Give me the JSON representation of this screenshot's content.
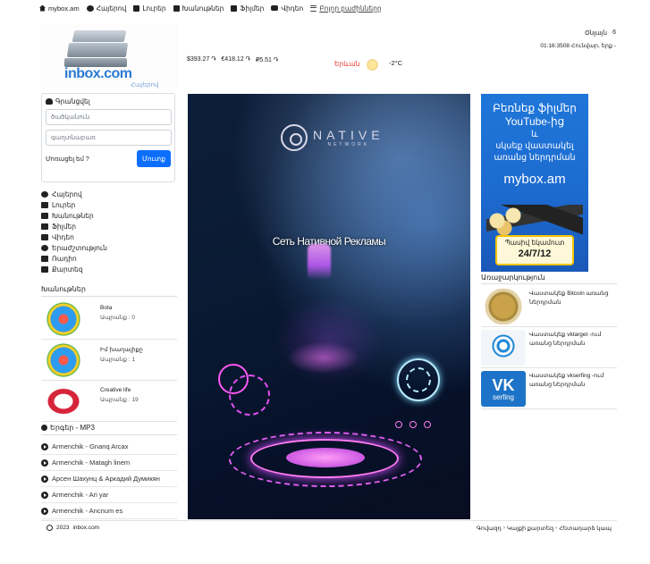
{
  "nav": {
    "site": "mybox.am",
    "items": [
      "Հայերով",
      "Լուրեր",
      "Խանութներ",
      "Ֆիլմեր",
      "Վիդեո"
    ],
    "all_sections": "Բոլոր բաժինները"
  },
  "logo": {
    "name": "inbox.com",
    "sub": "Հայերով"
  },
  "currency": {
    "usd": "$393.27 ֏",
    "eur": "€418.12 ֏",
    "rub": "₽5.51 ֏"
  },
  "weather": {
    "city": "Երևան",
    "temp": "-2°C"
  },
  "clock": {
    "label": "Օնլայն",
    "count": "6",
    "datetime": "01:16:3508 Հունվար, երք -"
  },
  "login": {
    "title": "Գրանցվել",
    "username_placeholder": "ծածկանուն",
    "password_placeholder": "գաղտնաբառ",
    "forgot": "Մոռացել եմ ?",
    "submit": "Մուտք"
  },
  "sidemenu": [
    "Հայերով",
    "Լուրեր",
    "Խանութներ",
    "Ֆիլմեր",
    "Վիդեո",
    "Երաժշտություն",
    "Ռադիո",
    "Քարտեզ"
  ],
  "shops": {
    "title": "Խանութներ",
    "items": [
      {
        "name": "Bota",
        "count": "Ապրանք : 0"
      },
      {
        "name": "Իմ խաղալիքը",
        "count": "Ապրանք : 1"
      },
      {
        "name": "Creative life",
        "count": "Ապրանք : 19"
      }
    ]
  },
  "songs": {
    "title": "Երգեր - MP3",
    "items": [
      "Armenchik - Gnanq Arcax",
      "Armenchik - Matagh linem",
      "Арсен Шахунц & Аркадий Думикян",
      "Armenchik - Ari yar",
      "Armenchik - Ancnum es"
    ]
  },
  "ad_main": {
    "brand": "NATIVE",
    "brand_sub": "NETWORK",
    "tagline": "Сеть Нативной Рекламы"
  },
  "ad_right": {
    "line1": "Բեռնեք ֆիլմեր",
    "line2": "YouTube-ից",
    "line3": "և",
    "line4": "սկսեք վաստակել",
    "line5": "առանց ներդրման",
    "site": "mybox.am",
    "ticket_label": "Պասիվ եկամուտ",
    "ticket_date": "24/7/12"
  },
  "offers": {
    "title": "Առաջարկություն",
    "items": [
      "Վաստակեք Bitcoin առանց ներդրման",
      "Վաստակեք vktarget -ում առանց ներդրման",
      "Վաստակեք vkserfing -ում առանց ներդրման"
    ],
    "vk_brand": "VK",
    "vk_sub": "serfing"
  },
  "footer": {
    "year": "2023",
    "site": "inbox.com",
    "links": [
      "Գովազդ",
      "Կայքի քարտեզ",
      "Հետադարձ կապ"
    ]
  }
}
